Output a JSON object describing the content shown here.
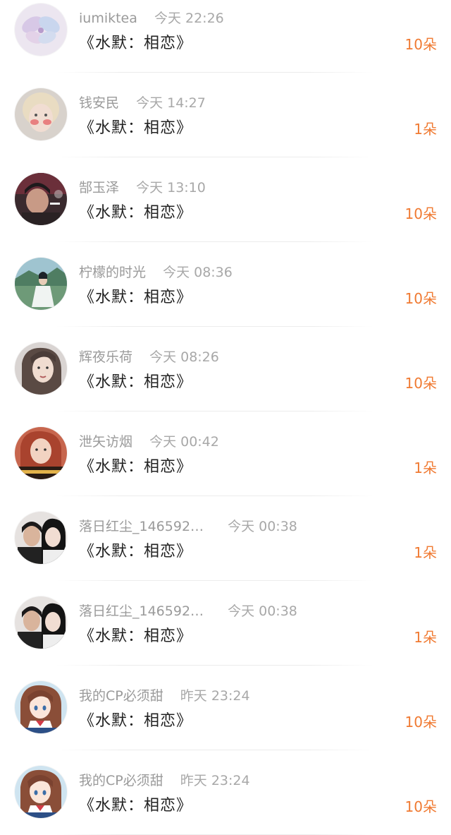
{
  "title_text": "《水默：相恋》",
  "accent_color": "#f07a32",
  "rows": [
    {
      "name": "iumiktea",
      "time": "今天 22:26",
      "title": "《水默：相恋》",
      "count": "10朵",
      "avatar": "flower-illustration-avatar"
    },
    {
      "name": "钱安民",
      "time": "今天 14:27",
      "title": "《水默：相恋》",
      "count": "1朵",
      "avatar": "child-photo-avatar"
    },
    {
      "name": "郜玉泽",
      "time": "今天 13:10",
      "title": "《水默：相恋》",
      "count": "10朵",
      "avatar": "smoker-photo-avatar"
    },
    {
      "name": "柠檬的时光",
      "time": "今天 08:36",
      "title": "《水默：相恋》",
      "count": "10朵",
      "avatar": "costume-photo-avatar"
    },
    {
      "name": "辉夜乐荷",
      "time": "今天 08:26",
      "title": "《水默：相恋》",
      "count": "10朵",
      "avatar": "woman-portrait-avatar"
    },
    {
      "name": "泄矢访烟",
      "time": "今天 00:42",
      "title": "《水默：相恋》",
      "count": "1朵",
      "avatar": "woman-poster-avatar"
    },
    {
      "name": "落日红尘_146592…",
      "time": "今天 00:38",
      "title": "《水默：相恋》",
      "count": "1朵",
      "avatar": "couple-photo-avatar"
    },
    {
      "name": "落日红尘_146592…",
      "time": "今天 00:38",
      "title": "《水默：相恋》",
      "count": "1朵",
      "avatar": "couple-photo-avatar"
    },
    {
      "name": "我的CP必须甜",
      "time": "昨天 23:24",
      "title": "《水默：相恋》",
      "count": "10朵",
      "avatar": "anime-girl-avatar"
    },
    {
      "name": "我的CP必须甜",
      "time": "昨天 23:24",
      "title": "《水默：相恋》",
      "count": "10朵",
      "avatar": "anime-girl-avatar"
    }
  ]
}
